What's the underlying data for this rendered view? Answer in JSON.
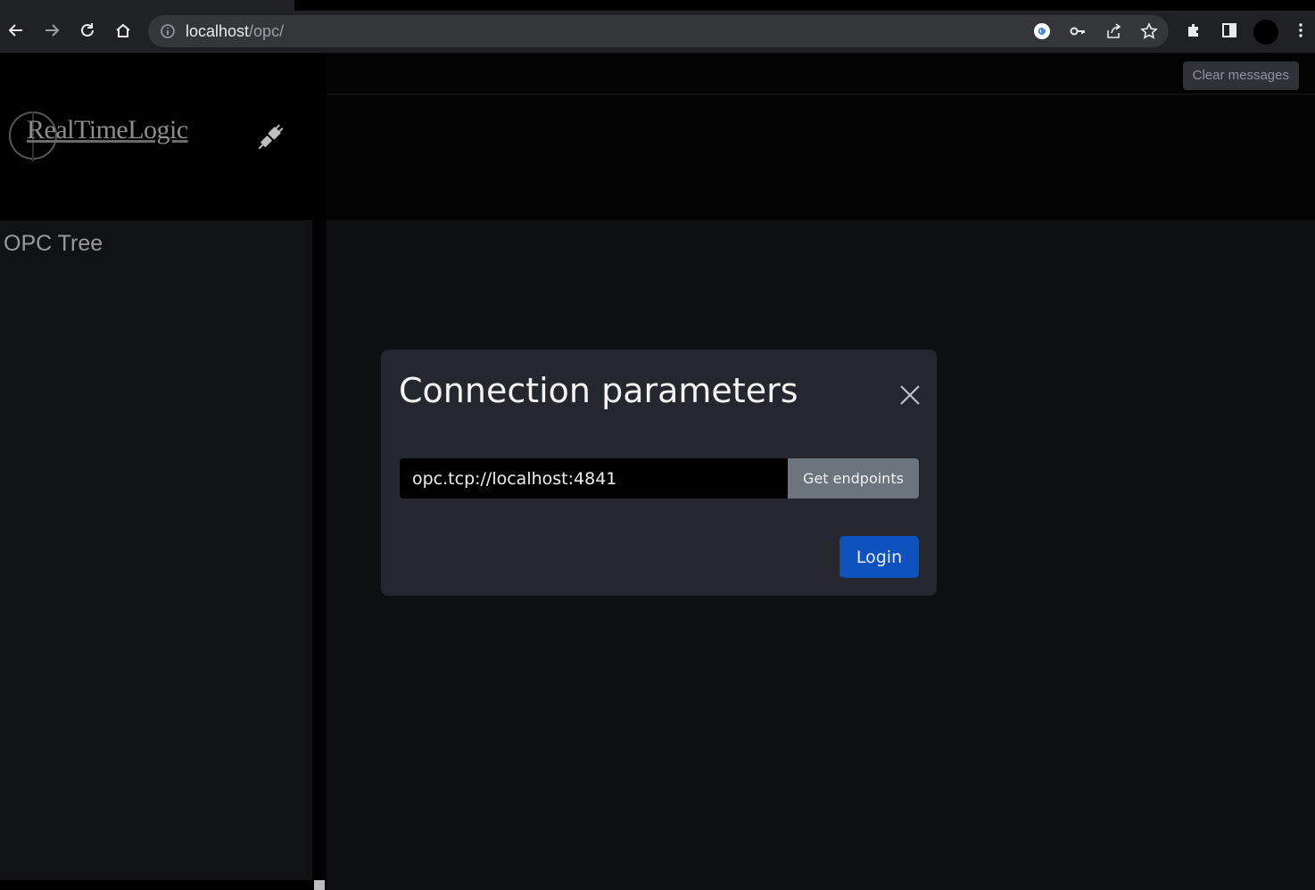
{
  "browser": {
    "url_host": "localhost",
    "url_path": "/opc/"
  },
  "app": {
    "logo_text": "RealTimeLogic",
    "tree_title": "OPC Tree",
    "clear_messages_label": "Clear messages"
  },
  "modal": {
    "title": "Connection parameters",
    "endpoint_value": "opc.tcp://localhost:4841",
    "get_endpoints_label": "Get endpoints",
    "login_label": "Login"
  },
  "colors": {
    "primary": "#0d52bf",
    "secondary": "#6c757d",
    "modal_bg": "#25272e"
  }
}
